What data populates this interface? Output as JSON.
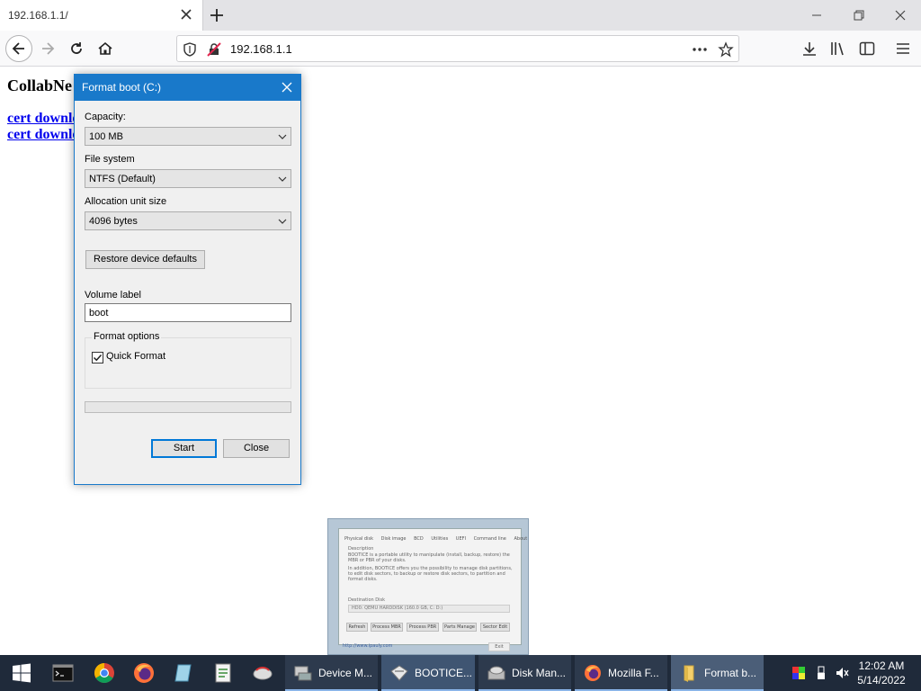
{
  "browser": {
    "tab_title": "192.168.1.1/",
    "url": "192.168.1.1"
  },
  "page": {
    "title": "CollabNe",
    "links": [
      "cert downlo",
      "cert downlo"
    ]
  },
  "dialog": {
    "title": "Format boot (C:)",
    "capacity_label": "Capacity:",
    "capacity_value": "100 MB",
    "filesystem_label": "File system",
    "filesystem_value": "NTFS (Default)",
    "alloc_label": "Allocation unit size",
    "alloc_value": "4096 bytes",
    "restore_button": "Restore device defaults",
    "volume_label_label": "Volume label",
    "volume_label_value": "boot",
    "format_options_label": "Format options",
    "quick_format_label": "Quick Format",
    "quick_format_checked": true,
    "progress": 0,
    "start_button": "Start",
    "close_button": "Close"
  },
  "preview": {
    "tabs": [
      "Physical disk",
      "Disk image",
      "BCD",
      "Utilities",
      "UEFI",
      "Command line",
      "About"
    ],
    "desc_title": "Description",
    "desc_lines": [
      "BOOTICE is a portable utility to manipulate (install, backup, restore) the",
      "MBR or PBR of your disks.",
      "In addition, BOOTICE offers you the possibility to manage disk partitions,",
      "to edit disk sectors, to backup or restore disk sectors, to partition and",
      "format disks."
    ],
    "dest_label": "Destination Disk",
    "dest_value": "HD0: QEMU HARDDISK (160.0 GB, C: D:)",
    "buttons": [
      "Refresh",
      "Process MBR",
      "Process PBR",
      "Parts Manage",
      "Sector Edit"
    ],
    "url": "http://www.ipauly.com",
    "exit": "Exit"
  },
  "taskbar": {
    "apps": [
      {
        "label": "Device M...",
        "icon": "device-manager-icon"
      },
      {
        "label": "BOOTICE...",
        "icon": "bootice-icon"
      },
      {
        "label": "Disk Man...",
        "icon": "disk-management-icon"
      },
      {
        "label": "Mozilla F...",
        "icon": "firefox-icon"
      },
      {
        "label": "Format b...",
        "icon": "folder-icon"
      }
    ],
    "clock_time": "12:02 AM",
    "clock_date": "5/14/2022"
  },
  "colors": {
    "dialog_titlebar": "#1979ca",
    "link": "#0000ee",
    "taskbar": "#1f2a3a"
  }
}
